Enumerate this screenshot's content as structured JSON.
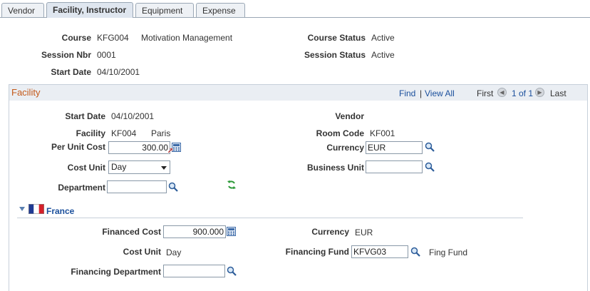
{
  "tabs": [
    "Vendor",
    "Facility, Instructor",
    "Equipment",
    "Expense"
  ],
  "header": {
    "course_label": "Course",
    "course_code": "KFG004",
    "course_name": "Motivation Management",
    "course_status_label": "Course Status",
    "course_status": "Active",
    "session_nbr_label": "Session Nbr",
    "session_nbr": "0001",
    "session_status_label": "Session Status",
    "session_status": "Active",
    "start_date_label": "Start Date",
    "start_date": "04/10/2001"
  },
  "facility": {
    "title": "Facility",
    "find": "Find",
    "separator": "|",
    "view_all": "View All",
    "first": "First",
    "range": "1 of 1",
    "last": "Last",
    "start_date_label": "Start Date",
    "start_date": "04/10/2001",
    "vendor_label": "Vendor",
    "facility_label": "Facility",
    "facility_code": "KF004",
    "facility_name": "Paris",
    "room_code_label": "Room Code",
    "room_code": "KF001",
    "per_unit_cost_label": "Per Unit Cost",
    "per_unit_cost": "300.00",
    "currency_label": "Currency",
    "currency": "EUR",
    "cost_unit_label": "Cost Unit",
    "cost_unit": "Day",
    "business_unit_label": "Business Unit",
    "business_unit": "",
    "department_label": "Department",
    "department": ""
  },
  "france": {
    "label": "France",
    "financed_cost_label": "Financed Cost",
    "financed_cost": "900.000",
    "currency_label": "Currency",
    "currency": "EUR",
    "cost_unit_label": "Cost Unit",
    "cost_unit": "Day",
    "financing_fund_label": "Financing Fund",
    "financing_fund": "KFVG03",
    "financing_fund_desc": "Fing Fund",
    "financing_department_label": "Financing Department",
    "financing_department": ""
  },
  "colors": {
    "link": "#1a4f9c",
    "section_title": "#c45a1b",
    "header_bg": "#eaeef3"
  }
}
